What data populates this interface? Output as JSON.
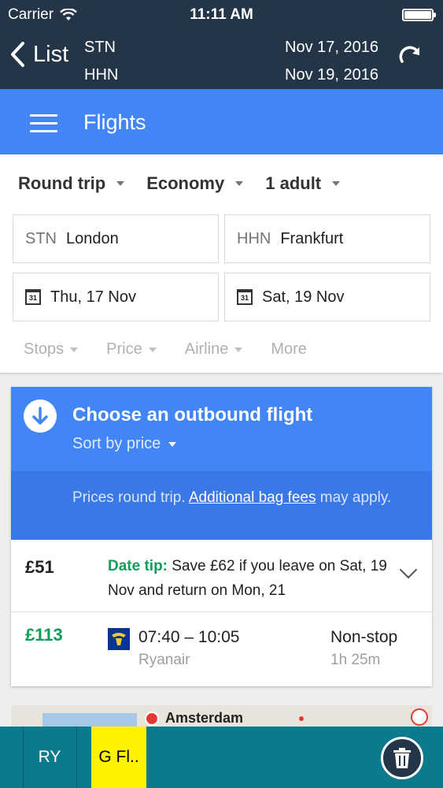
{
  "status_bar": {
    "carrier": "Carrier",
    "time": "11:11 AM"
  },
  "nav": {
    "back_label": "List",
    "origin_code": "STN",
    "destination_code": "HHN",
    "depart_date": "Nov 17, 2016",
    "return_date": "Nov 19, 2016"
  },
  "app_bar": {
    "title": "Flights"
  },
  "search": {
    "trip_type": "Round trip",
    "cabin": "Economy",
    "passengers": "1 adult",
    "from": {
      "code": "STN",
      "city": "London"
    },
    "to": {
      "code": "HHN",
      "city": "Frankfurt"
    },
    "depart": "Thu, 17 Nov",
    "return": "Sat, 19 Nov",
    "calendar_icon_text": "31",
    "filters": [
      "Stops",
      "Price",
      "Airline",
      "More"
    ]
  },
  "results": {
    "heading": "Choose an outbound flight",
    "sort_label": "Sort by price",
    "note_prefix": "Prices round trip. ",
    "note_link": "Additional bag fees",
    "note_suffix": " may apply.",
    "tip": {
      "price": "£51",
      "label": "Date tip:",
      "text": " Save £62 if you leave on Sat, 19 Nov and return on Mon, 21"
    },
    "flights": [
      {
        "price": "£113",
        "times": "07:40 – 10:05",
        "airline": "Ryanair",
        "stops": "Non-stop",
        "duration": "1h 25m"
      }
    ]
  },
  "map": {
    "label": "Amsterdam"
  },
  "bottom_bar": {
    "tabs": [
      "RY",
      "G Fl.."
    ]
  },
  "colors": {
    "nav_bg": "#233547",
    "primary": "#4285f4",
    "primary_dark": "#3b78e7",
    "green": "#0f9d58",
    "bottom_bar": "#0b7a8c",
    "highlight_tab": "#fff200"
  },
  "icons": {
    "back": "chevron-left-icon",
    "refresh": "refresh-icon",
    "menu": "hamburger-icon",
    "calendar": "calendar-icon",
    "sort_direction": "arrow-down-circle-icon",
    "expand": "chevron-down-icon",
    "airline_logo": "ryanair-logo",
    "delete": "trash-icon"
  }
}
